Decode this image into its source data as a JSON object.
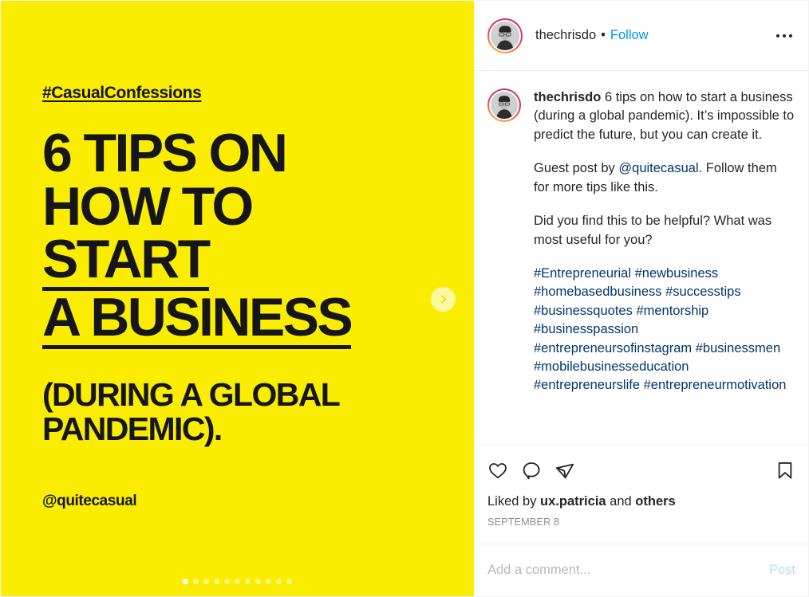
{
  "colors": {
    "slide_background": "#fbed00",
    "slide_text": "#16161a",
    "link_blue": "#0095f6",
    "hashtag_blue": "#00376b",
    "muted_gray": "#8e8e8e",
    "post_disabled": "#b2dffc",
    "divider": "#efefef"
  },
  "media": {
    "slide_hashtag": "#CasualConfessions",
    "headline_lines": [
      "6 TIPS ON",
      "HOW TO",
      "START",
      "A BUSINESS"
    ],
    "headline_underlined": [
      false,
      false,
      true,
      true
    ],
    "subheadline_lines": [
      "(DURING  A GLOBAL",
      "PANDEMIC)."
    ],
    "handle": "@quitecasual",
    "carousel": {
      "total_slides": 11,
      "active_slide": 1,
      "next_icon": "chevron-right-icon"
    }
  },
  "header": {
    "avatar": "profile-avatar",
    "username": "thechrisdo",
    "separator": "•",
    "follow_label": "Follow",
    "more_icon": "more-options-icon"
  },
  "caption": {
    "avatar": "profile-avatar",
    "username": "thechrisdo",
    "paragraph_1": " 6 tips on how to start a business (during a global pandemic). It’s impossible to predict the future, but you can create it.",
    "paragraph_2_pre": "Guest post by ",
    "paragraph_2_mention": "@quitecasual",
    "paragraph_2_post": ". Follow them for more tips like this.",
    "paragraph_3": "Did you find this to be helpful? What was most useful for you?",
    "hashtags": [
      "#Entrepreneurial",
      "#newbusiness",
      "#homebasedbusiness",
      "#successtips",
      "#businessquotes",
      "#mentorship",
      "#businesspassion",
      "#entrepreneursofinstagram",
      "#businessmen",
      "#mobilebusinesseducation",
      "#entrepreneurslife",
      "#entrepreneurmotivation"
    ]
  },
  "actions": {
    "like_icon": "heart-icon",
    "comment_icon": "comment-bubble-icon",
    "share_icon": "share-paper-plane-icon",
    "save_icon": "bookmark-icon",
    "liked_by_prefix": "Liked by ",
    "liked_by_user": "ux.patricia",
    "liked_by_middle": " and ",
    "liked_by_suffix": "others",
    "date": "SEPTEMBER 8"
  },
  "comment_box": {
    "placeholder": "Add a comment...",
    "value": "",
    "post_label": "Post"
  }
}
